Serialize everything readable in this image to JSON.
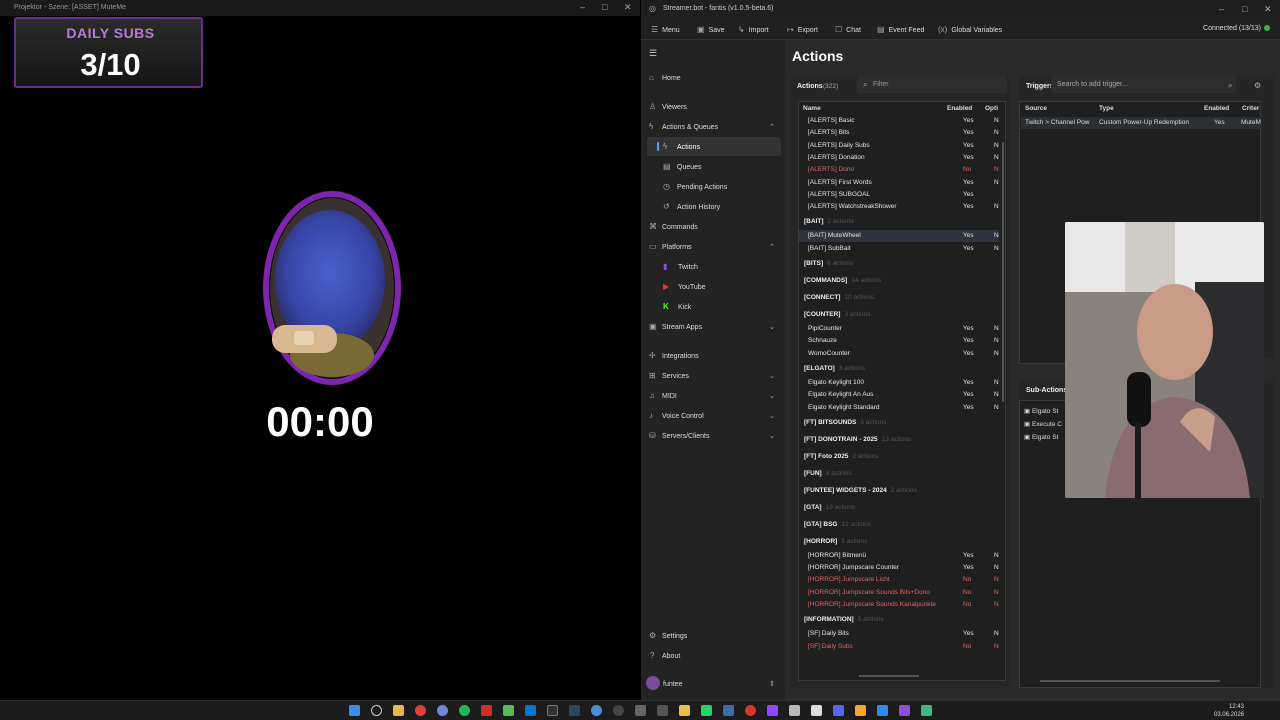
{
  "projector": {
    "title": "Projektor - Szene: [ASSET] MuteMe",
    "overlay_title": "DAILY SUBS",
    "overlay_count": "3/10",
    "timer": "00:00"
  },
  "streamerbot": {
    "title": "Streamer.bot - fantis (v1.0.5-beta.6)",
    "toolbar": [
      "Menu",
      "Save",
      "Import",
      "Export",
      "Chat",
      "Event Feed",
      "Global Variables"
    ],
    "connection": "Connected (13/13)",
    "nav": [
      {
        "label": "Home",
        "icon": "home-icon"
      },
      {
        "label": "Viewers",
        "icon": "user-icon"
      },
      {
        "label": "Actions & Queues",
        "icon": "bolt-icon"
      },
      {
        "label": "Actions",
        "icon": "bolt-icon"
      },
      {
        "label": "Queues",
        "icon": "queue-icon"
      },
      {
        "label": "Pending Actions",
        "icon": "pending-icon"
      },
      {
        "label": "Action History",
        "icon": "history-icon"
      },
      {
        "label": "Commands",
        "icon": "command-icon"
      },
      {
        "label": "Platforms",
        "icon": "platform-icon"
      },
      {
        "label": "Twitch",
        "icon": "twitch-icon"
      },
      {
        "label": "YouTube",
        "icon": "youtube-icon"
      },
      {
        "label": "Kick",
        "icon": "kick-icon"
      },
      {
        "label": "Stream Apps",
        "icon": "apps-icon"
      },
      {
        "label": "Integrations",
        "icon": "integrations-icon"
      },
      {
        "label": "Services",
        "icon": "services-icon"
      },
      {
        "label": "MIDI",
        "icon": "midi-icon"
      },
      {
        "label": "Voice Control",
        "icon": "voice-icon"
      },
      {
        "label": "Servers/Clients",
        "icon": "server-icon"
      },
      {
        "label": "Settings",
        "icon": "gear-icon"
      },
      {
        "label": "About",
        "icon": "question-icon"
      }
    ],
    "user": "funtee",
    "page_title": "Actions",
    "actions_header": "Actions",
    "actions_count": "(322)",
    "filter_placeholder": "Filter",
    "columns": [
      "Name",
      "Enabled",
      "Opti"
    ],
    "triggers_header": "Triggers",
    "triggers_search": "Search to add trigger...",
    "trigger_columns": [
      "Source",
      "Type",
      "Enabled",
      "Criter"
    ],
    "trigger_row": [
      "Twitch > Channel Pow",
      "Custom Power-Up Redemption",
      "Yes",
      "MuteM"
    ],
    "subactions_header": "Sub-Actions",
    "subactions": [
      "Elgato St",
      "Execute C",
      "Elgato St"
    ],
    "clock_time": "12:43",
    "clock_date": "03.06.2026",
    "rows": [
      {
        "t": "row",
        "n": "[ALERTS] Basic",
        "e": "Yes",
        "o": "N"
      },
      {
        "t": "row",
        "n": "[ALERTS] Bits",
        "e": "Yes",
        "o": "N"
      },
      {
        "t": "row",
        "n": "[ALERTS] Daily Subs",
        "e": "Yes",
        "o": "N"
      },
      {
        "t": "row",
        "n": "[ALERTS] Donation",
        "e": "Yes",
        "o": "N"
      },
      {
        "t": "row",
        "n": "[ALERTS] Dono",
        "e": "No",
        "o": "N",
        "red": true
      },
      {
        "t": "row",
        "n": "[ALERTS] First Words",
        "e": "Yes",
        "o": "N"
      },
      {
        "t": "row",
        "n": "[ALERTS] SUBGOAL",
        "e": "Yes",
        "o": ""
      },
      {
        "t": "row",
        "n": "[ALERTS] WatchstreakShower",
        "e": "Yes",
        "o": "N"
      },
      {
        "t": "grp",
        "n": "[BAIT]",
        "c": "2 actions"
      },
      {
        "t": "row",
        "n": "[BAIT] MuteWheel",
        "e": "Yes",
        "o": "N",
        "sel": true
      },
      {
        "t": "row",
        "n": "[BAIT] SubBait",
        "e": "Yes",
        "o": "N"
      },
      {
        "t": "grp",
        "n": "[BITS]",
        "c": "6 actions"
      },
      {
        "t": "grp",
        "n": "[COMMANDS]",
        "c": "14 actions"
      },
      {
        "t": "grp",
        "n": "[CONNECT]",
        "c": "10 actions"
      },
      {
        "t": "grp",
        "n": "[COUNTER]",
        "c": "3 actions"
      },
      {
        "t": "row",
        "n": "PipiCounter",
        "e": "Yes",
        "o": "N"
      },
      {
        "t": "row",
        "n": "Schnauze",
        "e": "Yes",
        "o": "N"
      },
      {
        "t": "row",
        "n": "WomoCounter",
        "e": "Yes",
        "o": "N"
      },
      {
        "t": "grp",
        "n": "[ELGATO]",
        "c": "3 actions"
      },
      {
        "t": "row",
        "n": "Elgato Keylight 100",
        "e": "Yes",
        "o": "N"
      },
      {
        "t": "row",
        "n": "Elgato Keylight An Aus",
        "e": "Yes",
        "o": "N"
      },
      {
        "t": "row",
        "n": "Elgato Keylight Standard",
        "e": "Yes",
        "o": "N"
      },
      {
        "t": "grp",
        "n": "[FT] BITSOUNDS",
        "c": "5 actions"
      },
      {
        "t": "grp",
        "n": "[FT] DONOTRAIN - 2025",
        "c": "13 actions"
      },
      {
        "t": "grp",
        "n": "[FT] Foto 2025",
        "c": "2 actions"
      },
      {
        "t": "grp",
        "n": "[FUN]",
        "c": "8 actions"
      },
      {
        "t": "grp",
        "n": "[FUNTEE] WIDGETS - 2024",
        "c": "2 actions"
      },
      {
        "t": "grp",
        "n": "[GTA]",
        "c": "19 actions"
      },
      {
        "t": "grp",
        "n": "[GTA] BSG",
        "c": "12 actions"
      },
      {
        "t": "grp",
        "n": "[HORROR]",
        "c": "5 actions"
      },
      {
        "t": "row",
        "n": "[HORROR] Bitmenü",
        "e": "Yes",
        "o": "N"
      },
      {
        "t": "row",
        "n": "[HORROR] Jumpscare Counter",
        "e": "Yes",
        "o": "N"
      },
      {
        "t": "row",
        "n": "[HORROR] Jumpscare Licht",
        "e": "No",
        "o": "N",
        "red": true
      },
      {
        "t": "row",
        "n": "[HORROR] Jumpscare Sounds Bits+Dono",
        "e": "No",
        "o": "N",
        "red": true
      },
      {
        "t": "row",
        "n": "[HORROR] Jumpscare Sounds Kanalpunkte",
        "e": "No",
        "o": "N",
        "red": true
      },
      {
        "t": "grp",
        "n": "[INFORMATION]",
        "c": "5 actions"
      },
      {
        "t": "row",
        "n": "[SF] Daily Bits",
        "e": "Yes",
        "o": "N"
      },
      {
        "t": "row",
        "n": "[SF] Daily Subs",
        "e": "No",
        "o": "N",
        "red": true
      }
    ]
  }
}
